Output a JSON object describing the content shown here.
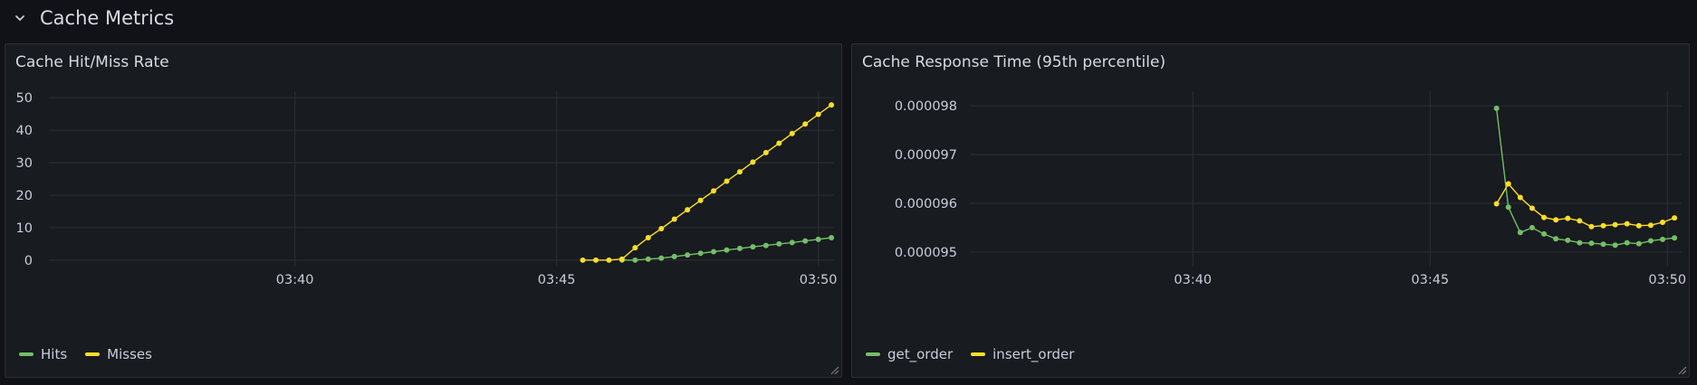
{
  "row": {
    "title": "Cache Metrics"
  },
  "colors": {
    "hits": "#73bf69",
    "misses": "#fade2a",
    "grid": "#2c2f35",
    "tick": "#ccccdc"
  },
  "panels": [
    {
      "title": "Cache Hit/Miss Rate",
      "legend": [
        "Hits",
        "Misses"
      ]
    },
    {
      "title": "Cache Response Time (95th percentile)",
      "legend": [
        "get_order",
        "insert_order"
      ]
    }
  ],
  "chart_data": [
    {
      "type": "line",
      "title": "Cache Hit/Miss Rate",
      "x_ticks": [
        "03:40",
        "03:45",
        "03:50"
      ],
      "x_tick_minutes": [
        40,
        45,
        50
      ],
      "xlim": [
        35.3,
        50.3
      ],
      "y_ticks": [
        "0",
        "10",
        "20",
        "30",
        "40",
        "50"
      ],
      "y_tick_values": [
        0,
        10,
        20,
        30,
        40,
        50
      ],
      "ylim": [
        -2,
        52
      ],
      "grid": true,
      "legend": "bottom-left",
      "series": [
        {
          "name": "Hits",
          "color": "#73bf69",
          "x": [
            46.25,
            46.5,
            46.75,
            47.0,
            47.25,
            47.5,
            47.75,
            48.0,
            48.25,
            48.5,
            48.75,
            49.0,
            49.25,
            49.5,
            49.75,
            50.0,
            50.25
          ],
          "y": [
            0,
            0,
            0.3,
            0.6,
            1.1,
            1.6,
            2.1,
            2.6,
            3.1,
            3.6,
            4.1,
            4.5,
            5.0,
            5.4,
            5.9,
            6.4,
            6.9
          ]
        },
        {
          "name": "Misses",
          "color": "#fade2a",
          "x": [
            45.5,
            45.75,
            46.0,
            46.25,
            46.5,
            46.75,
            47.0,
            47.25,
            47.5,
            47.75,
            48.0,
            48.25,
            48.5,
            48.75,
            49.0,
            49.25,
            49.5,
            49.75,
            50.0,
            50.25
          ],
          "y": [
            0,
            0,
            0,
            0.3,
            3.8,
            6.9,
            9.7,
            12.6,
            15.5,
            18.4,
            21.3,
            24.3,
            27.2,
            30.2,
            33.1,
            36.0,
            39.0,
            41.9,
            44.9,
            47.8
          ]
        }
      ]
    },
    {
      "type": "line",
      "title": "Cache Response Time (95th percentile)",
      "x_ticks": [
        "03:40",
        "03:45",
        "03:50"
      ],
      "x_tick_minutes": [
        40,
        45,
        50
      ],
      "xlim": [
        35.3,
        50.3
      ],
      "y_ticks": [
        "0.000098",
        "0.000097",
        "0.000096",
        "0.000095"
      ],
      "y_tick_values": [
        9.8e-05,
        9.7e-05,
        9.6e-05,
        9.5e-05
      ],
      "ylim": [
        9.47e-05,
        9.83e-05
      ],
      "grid": true,
      "legend": "bottom-left",
      "series": [
        {
          "name": "get_order",
          "color": "#73bf69",
          "x": [
            46.4,
            46.65,
            46.9,
            47.15,
            47.4,
            47.65,
            47.9,
            48.15,
            48.4,
            48.65,
            48.9,
            49.15,
            49.4,
            49.65,
            49.9,
            50.15
          ],
          "y": [
            9.795e-05,
            9.592e-05,
            9.54e-05,
            9.55e-05,
            9.537e-05,
            9.527e-05,
            9.524e-05,
            9.519e-05,
            9.518e-05,
            9.516e-05,
            9.514e-05,
            9.519e-05,
            9.517e-05,
            9.523e-05,
            9.526e-05,
            9.529e-05
          ]
        },
        {
          "name": "insert_order",
          "color": "#fade2a",
          "x": [
            46.4,
            46.65,
            46.9,
            47.15,
            47.4,
            47.65,
            47.9,
            48.15,
            48.4,
            48.65,
            48.9,
            49.15,
            49.4,
            49.65,
            49.9,
            50.15
          ],
          "y": [
            9.599e-05,
            9.64e-05,
            9.612e-05,
            9.59e-05,
            9.571e-05,
            9.566e-05,
            9.569e-05,
            9.564e-05,
            9.552e-05,
            9.554e-05,
            9.556e-05,
            9.558e-05,
            9.554e-05,
            9.555e-05,
            9.561e-05,
            9.57e-05
          ]
        }
      ]
    }
  ]
}
